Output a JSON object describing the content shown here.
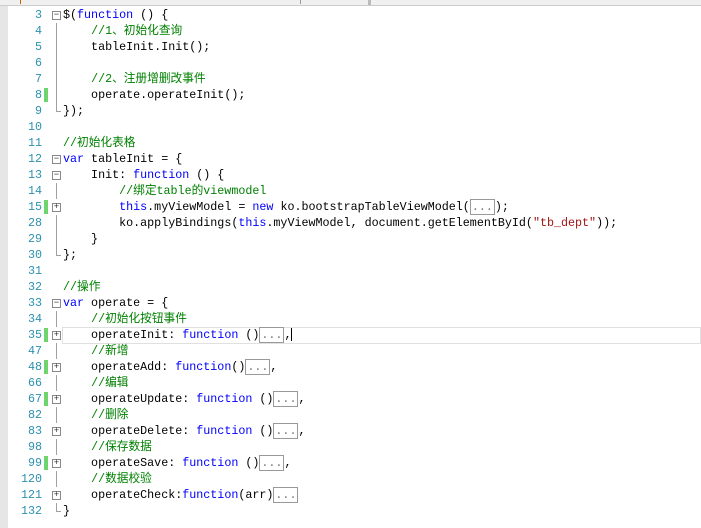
{
  "editor": {
    "lines": [
      {
        "n": "3",
        "fold": "minus",
        "guide": "",
        "chg": false,
        "tokens": [
          [
            "t",
            "$("
          ],
          [
            "k",
            "function"
          ],
          [
            "t",
            " () {"
          ]
        ]
      },
      {
        "n": "4",
        "fold": "",
        "guide": "mid",
        "chg": false,
        "tokens": [
          [
            "t",
            "    "
          ],
          [
            "c",
            "//1、初始化查询"
          ]
        ]
      },
      {
        "n": "5",
        "fold": "",
        "guide": "mid",
        "chg": false,
        "tokens": [
          [
            "t",
            "    tableInit.Init();"
          ]
        ]
      },
      {
        "n": "6",
        "fold": "",
        "guide": "mid",
        "chg": false,
        "tokens": []
      },
      {
        "n": "7",
        "fold": "",
        "guide": "mid",
        "chg": false,
        "tokens": [
          [
            "t",
            "    "
          ],
          [
            "c",
            "//2、注册增删改事件"
          ]
        ]
      },
      {
        "n": "8",
        "fold": "",
        "guide": "mid",
        "chg": true,
        "tokens": [
          [
            "t",
            "    operate.operateInit();"
          ]
        ]
      },
      {
        "n": "9",
        "fold": "",
        "guide": "end",
        "chg": false,
        "tokens": [
          [
            "t",
            "});"
          ]
        ]
      },
      {
        "n": "10",
        "fold": "",
        "guide": "",
        "chg": false,
        "tokens": []
      },
      {
        "n": "11",
        "fold": "",
        "guide": "",
        "chg": false,
        "tokens": [
          [
            "c",
            "//初始化表格"
          ]
        ]
      },
      {
        "n": "12",
        "fold": "minus",
        "guide": "",
        "chg": false,
        "tokens": [
          [
            "k",
            "var"
          ],
          [
            "t",
            " tableInit = {"
          ]
        ]
      },
      {
        "n": "13",
        "fold": "minus",
        "guide": "",
        "chg": false,
        "tokens": [
          [
            "t",
            "    Init: "
          ],
          [
            "k",
            "function"
          ],
          [
            "t",
            " () {"
          ]
        ]
      },
      {
        "n": "14",
        "fold": "",
        "guide": "mid",
        "chg": false,
        "tokens": [
          [
            "t",
            "        "
          ],
          [
            "c",
            "//绑定table的viewmodel"
          ]
        ]
      },
      {
        "n": "15",
        "fold": "plus",
        "guide": "",
        "chg": true,
        "tokens": [
          [
            "t",
            "        "
          ],
          [
            "k",
            "this"
          ],
          [
            "t",
            ".myViewModel = "
          ],
          [
            "k",
            "new"
          ],
          [
            "t",
            " ko.bootstrapTableViewModel("
          ],
          [
            "b",
            "..."
          ],
          [
            "t",
            ");"
          ]
        ]
      },
      {
        "n": "28",
        "fold": "",
        "guide": "mid",
        "chg": false,
        "tokens": [
          [
            "t",
            "        ko.applyBindings("
          ],
          [
            "k",
            "this"
          ],
          [
            "t",
            ".myViewModel, document.getElementById("
          ],
          [
            "s",
            "\"tb_dept\""
          ],
          [
            "t",
            "));"
          ]
        ]
      },
      {
        "n": "29",
        "fold": "",
        "guide": "mid",
        "chg": false,
        "tokens": [
          [
            "t",
            "    }"
          ]
        ]
      },
      {
        "n": "30",
        "fold": "",
        "guide": "end",
        "chg": false,
        "tokens": [
          [
            "t",
            "};"
          ]
        ]
      },
      {
        "n": "31",
        "fold": "",
        "guide": "",
        "chg": false,
        "tokens": []
      },
      {
        "n": "32",
        "fold": "",
        "guide": "",
        "chg": false,
        "tokens": [
          [
            "c",
            "//操作"
          ]
        ]
      },
      {
        "n": "33",
        "fold": "minus",
        "guide": "",
        "chg": false,
        "tokens": [
          [
            "k",
            "var"
          ],
          [
            "t",
            " operate = {"
          ]
        ]
      },
      {
        "n": "34",
        "fold": "",
        "guide": "mid",
        "chg": false,
        "tokens": [
          [
            "t",
            "    "
          ],
          [
            "c",
            "//初始化按钮事件"
          ]
        ]
      },
      {
        "n": "35",
        "fold": "plus",
        "guide": "",
        "chg": true,
        "current": true,
        "tokens": [
          [
            "t",
            "    operateInit: "
          ],
          [
            "k",
            "function"
          ],
          [
            "t",
            " ()"
          ],
          [
            "b",
            "..."
          ],
          [
            "t",
            ","
          ],
          [
            "caret",
            ""
          ]
        ]
      },
      {
        "n": "47",
        "fold": "",
        "guide": "mid",
        "chg": false,
        "tokens": [
          [
            "t",
            "    "
          ],
          [
            "c",
            "//新增"
          ]
        ]
      },
      {
        "n": "48",
        "fold": "plus",
        "guide": "",
        "chg": true,
        "tokens": [
          [
            "t",
            "    operateAdd: "
          ],
          [
            "k",
            "function"
          ],
          [
            "t",
            "()"
          ],
          [
            "b",
            "..."
          ],
          [
            "t",
            ","
          ]
        ]
      },
      {
        "n": "66",
        "fold": "",
        "guide": "mid",
        "chg": false,
        "tokens": [
          [
            "t",
            "    "
          ],
          [
            "c",
            "//编辑"
          ]
        ]
      },
      {
        "n": "67",
        "fold": "plus",
        "guide": "",
        "chg": true,
        "tokens": [
          [
            "t",
            "    operateUpdate: "
          ],
          [
            "k",
            "function"
          ],
          [
            "t",
            " ()"
          ],
          [
            "b",
            "..."
          ],
          [
            "t",
            ","
          ]
        ]
      },
      {
        "n": "82",
        "fold": "",
        "guide": "mid",
        "chg": false,
        "tokens": [
          [
            "t",
            "    "
          ],
          [
            "c",
            "//删除"
          ]
        ]
      },
      {
        "n": "83",
        "fold": "plus",
        "guide": "",
        "chg": false,
        "tokens": [
          [
            "t",
            "    operateDelete: "
          ],
          [
            "k",
            "function"
          ],
          [
            "t",
            " ()"
          ],
          [
            "b",
            "..."
          ],
          [
            "t",
            ","
          ]
        ]
      },
      {
        "n": "98",
        "fold": "",
        "guide": "mid",
        "chg": false,
        "tokens": [
          [
            "t",
            "    "
          ],
          [
            "c",
            "//保存数据"
          ]
        ]
      },
      {
        "n": "99",
        "fold": "plus",
        "guide": "",
        "chg": true,
        "tokens": [
          [
            "t",
            "    operateSave: "
          ],
          [
            "k",
            "function"
          ],
          [
            "t",
            " ()"
          ],
          [
            "b",
            "..."
          ],
          [
            "t",
            ","
          ]
        ]
      },
      {
        "n": "120",
        "fold": "",
        "guide": "mid",
        "chg": false,
        "tokens": [
          [
            "t",
            "    "
          ],
          [
            "c",
            "//数据校验"
          ]
        ]
      },
      {
        "n": "121",
        "fold": "plus",
        "guide": "",
        "chg": false,
        "tokens": [
          [
            "t",
            "    operateCheck:"
          ],
          [
            "k",
            "function"
          ],
          [
            "t",
            "(arr)"
          ],
          [
            "b",
            "..."
          ]
        ]
      },
      {
        "n": "132",
        "fold": "",
        "guide": "end",
        "chg": false,
        "tokens": [
          [
            "t",
            "}"
          ]
        ]
      }
    ]
  }
}
